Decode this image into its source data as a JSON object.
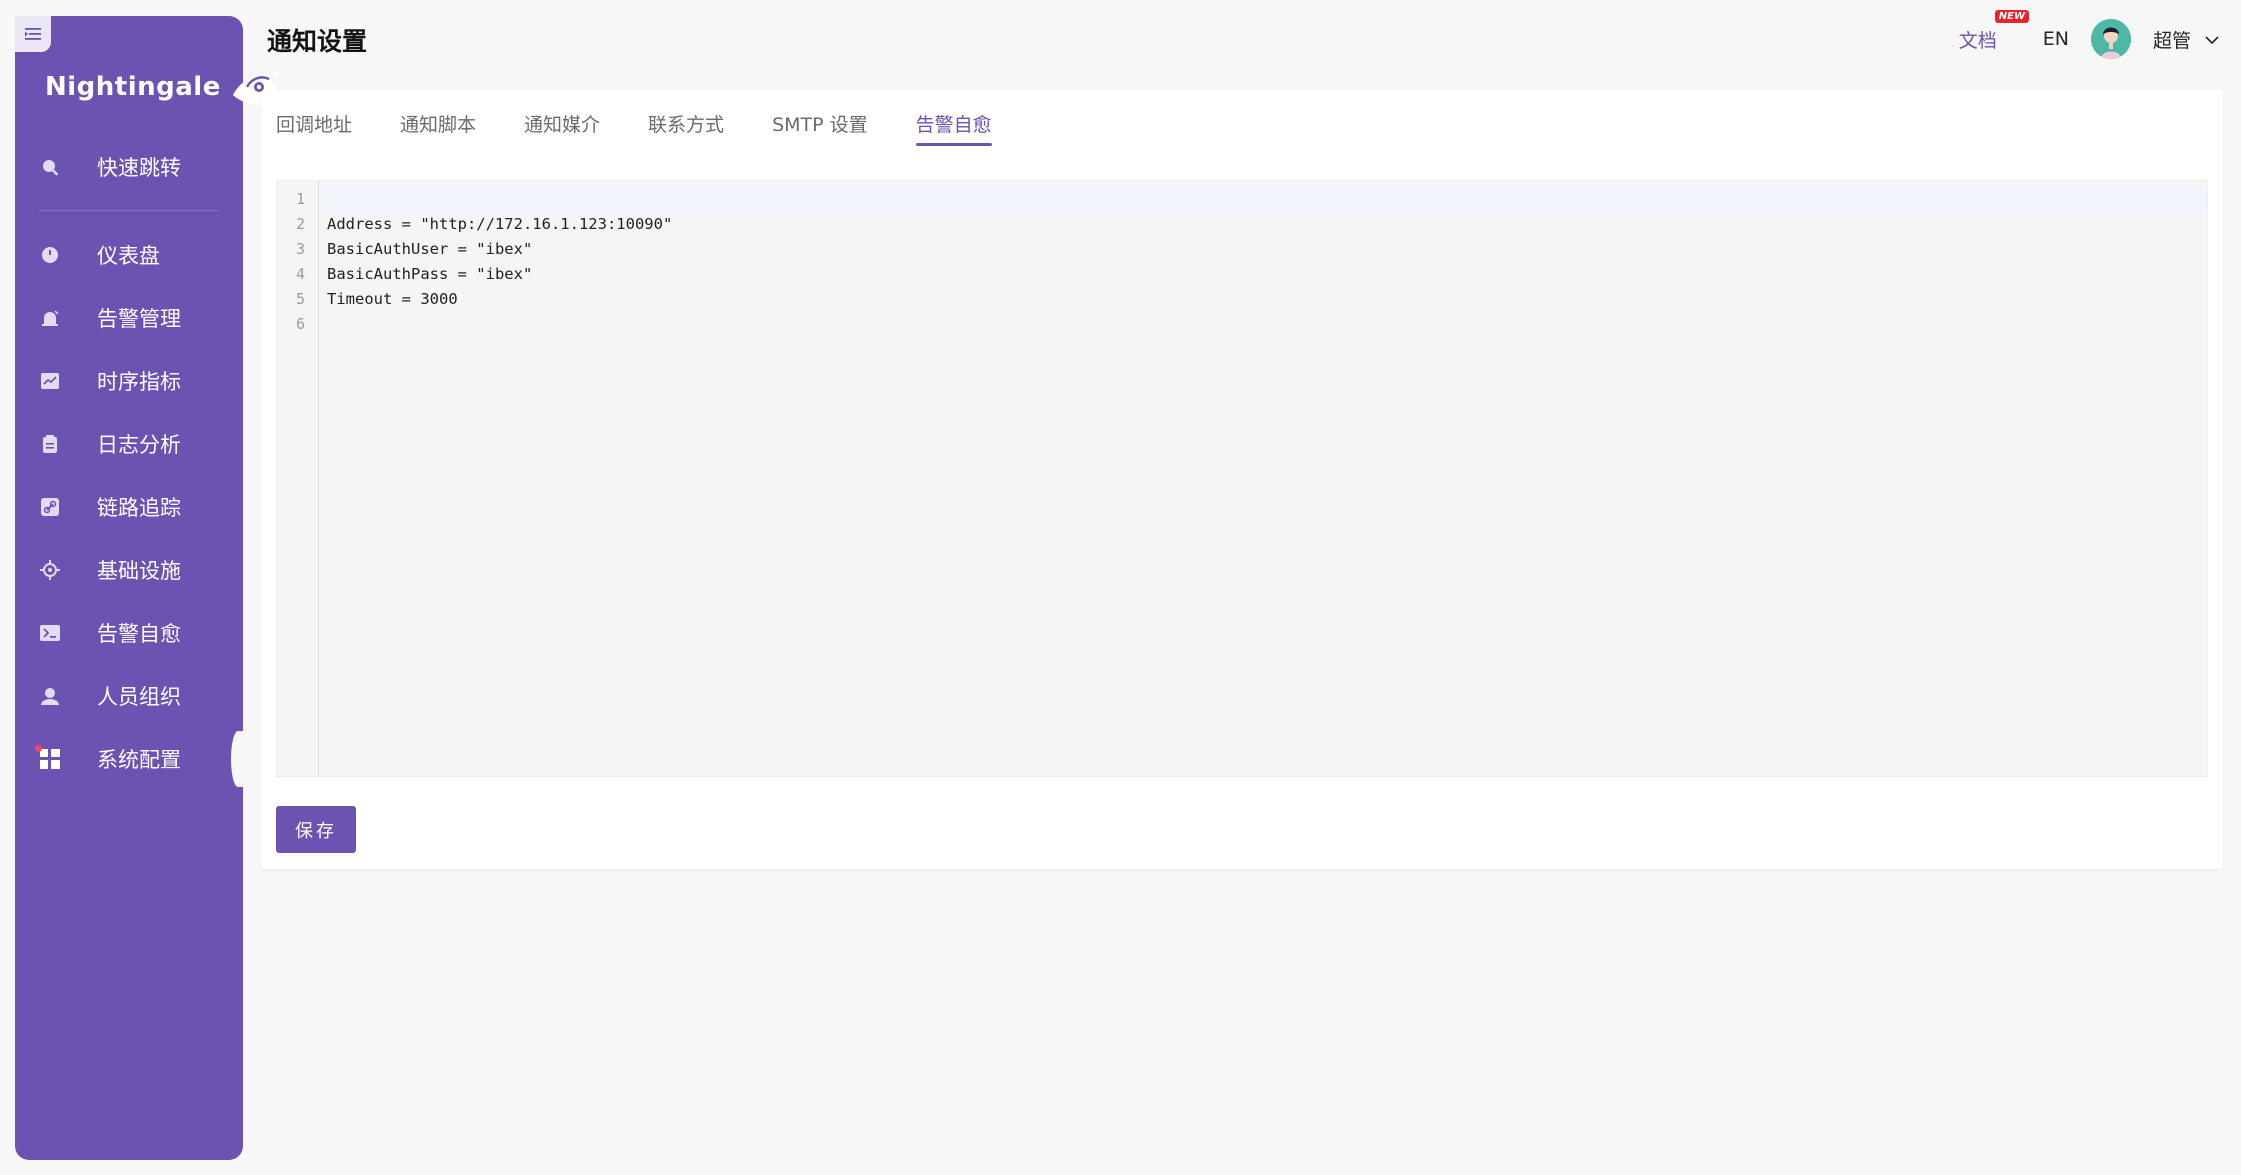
{
  "app": {
    "logo_text": "Nightingale"
  },
  "sidebar": {
    "collapse_icon": "menu-fold-icon",
    "quick_jump": {
      "label": "快速跳转",
      "icon": "search-icon"
    },
    "items": [
      {
        "label": "仪表盘",
        "icon": "dashboard-icon"
      },
      {
        "label": "告警管理",
        "icon": "alarm-icon"
      },
      {
        "label": "时序指标",
        "icon": "line-chart-icon"
      },
      {
        "label": "日志分析",
        "icon": "log-icon"
      },
      {
        "label": "链路追踪",
        "icon": "link-icon"
      },
      {
        "label": "基础设施",
        "icon": "target-icon"
      },
      {
        "label": "告警自愈",
        "icon": "terminal-icon"
      },
      {
        "label": "人员组织",
        "icon": "user-icon"
      },
      {
        "label": "系统配置",
        "icon": "grid-icon"
      }
    ],
    "active_index": 8,
    "colors": {
      "background": "#6c53b1",
      "active_dot": "#f5436b"
    }
  },
  "header": {
    "title": "通知设置",
    "docs_label": "文档",
    "new_badge": "NEW",
    "lang": "EN",
    "user_name": "超管"
  },
  "tabs": [
    {
      "label": "回调地址"
    },
    {
      "label": "通知脚本"
    },
    {
      "label": "通知媒介"
    },
    {
      "label": "联系方式"
    },
    {
      "label": "SMTP 设置"
    },
    {
      "label": "告警自愈"
    }
  ],
  "active_tab_index": 5,
  "editor": {
    "lines": [
      "",
      "Address = \"http://172.16.1.123:10090\"",
      "BasicAuthUser = \"ibex\"",
      "BasicAuthPass = \"ibex\"",
      "Timeout = 3000",
      ""
    ],
    "line_numbers": [
      "1",
      "2",
      "3",
      "4",
      "5",
      "6"
    ]
  },
  "actions": {
    "save_label": "保存"
  }
}
